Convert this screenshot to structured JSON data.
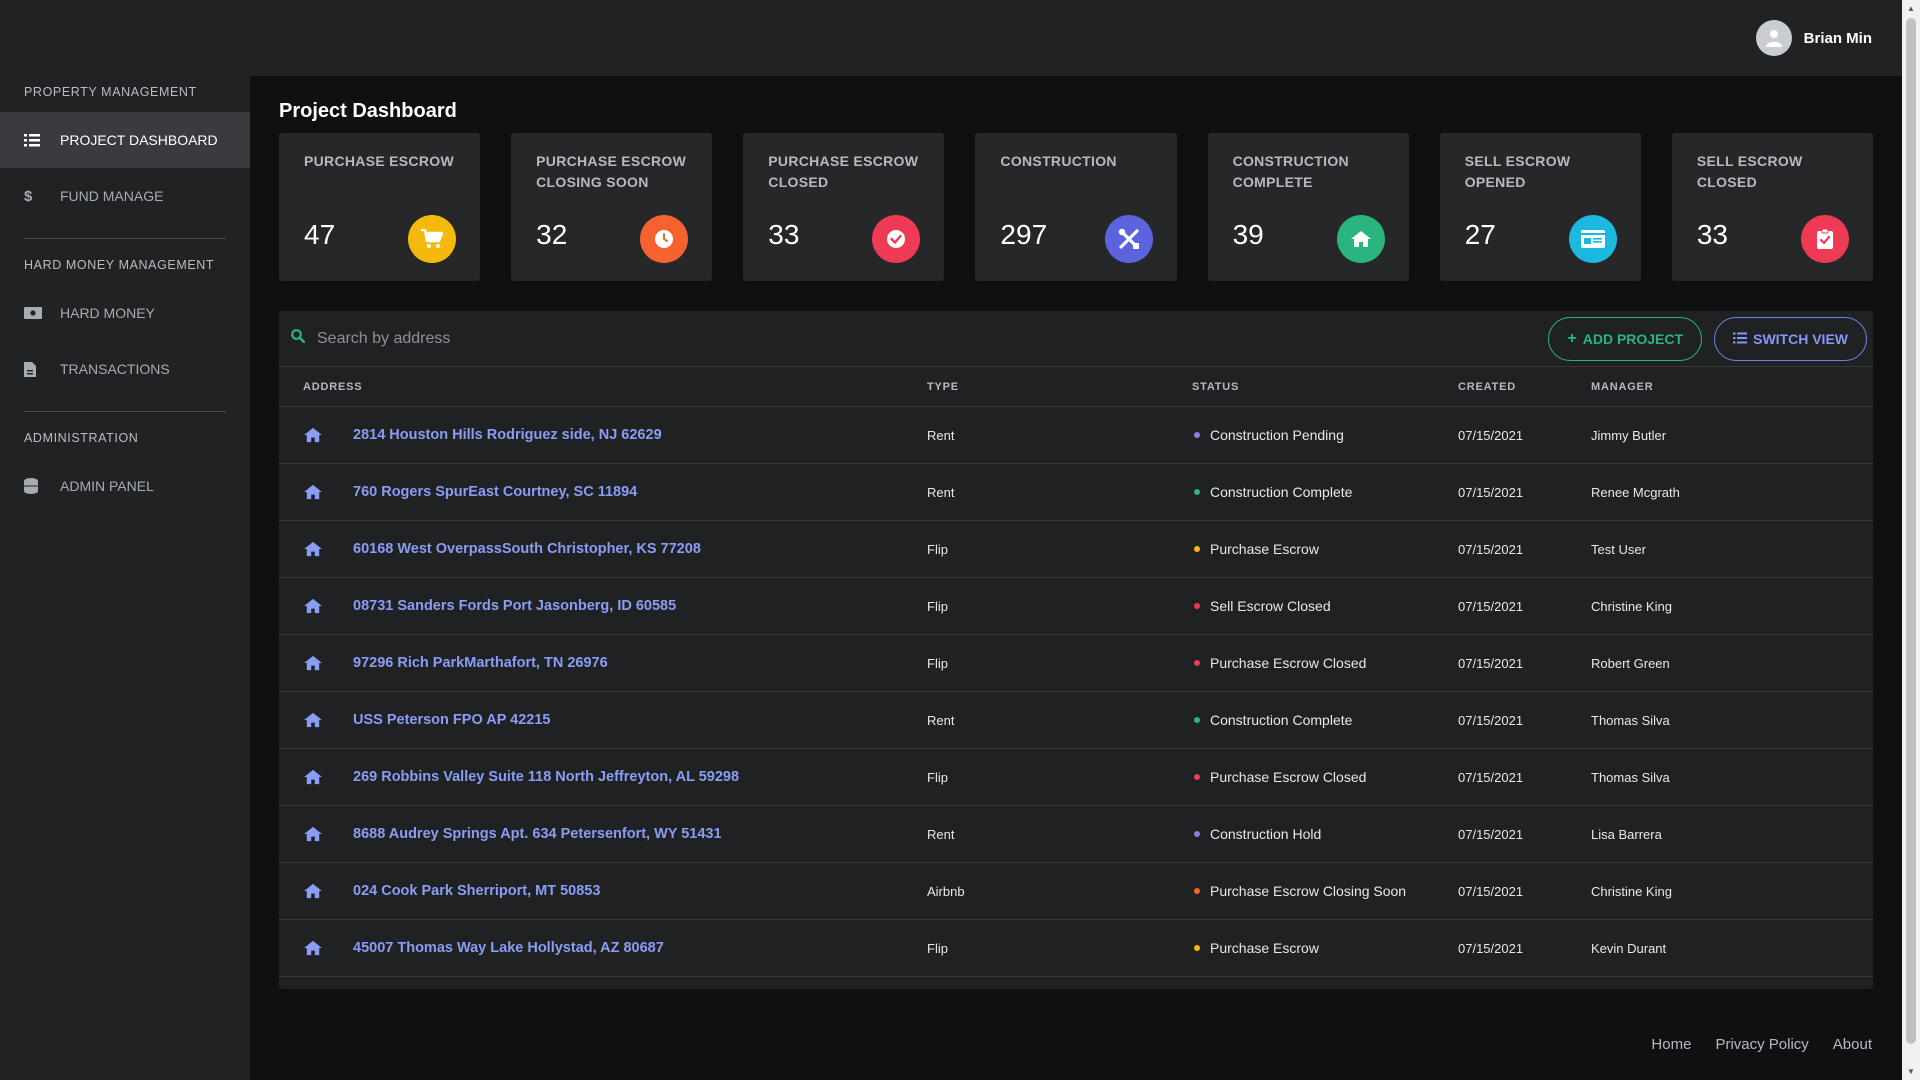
{
  "user": {
    "name": "Brian Min"
  },
  "sidebar": {
    "sections": [
      {
        "label": "PROPERTY MANAGEMENT",
        "items": [
          {
            "label": "PROJECT DASHBOARD",
            "icon": "list-icon",
            "active": true
          },
          {
            "label": "FUND MANAGE",
            "icon": "dollar-icon"
          }
        ]
      },
      {
        "label": "HARD MONEY MANAGEMENT",
        "items": [
          {
            "label": "HARD MONEY",
            "icon": "money-bill-icon"
          },
          {
            "label": "TRANSACTIONS",
            "icon": "file-invoice-icon"
          }
        ]
      },
      {
        "label": "ADMINISTRATION",
        "items": [
          {
            "label": "ADMIN PANEL",
            "icon": "database-icon"
          }
        ]
      }
    ]
  },
  "page": {
    "title": "Project Dashboard"
  },
  "cards": [
    {
      "title": "PURCHASE ESCROW",
      "value": "47",
      "color": "#f5b90d",
      "icon": "cart-icon"
    },
    {
      "title": "PURCHASE ESCROW CLOSING SOON",
      "value": "32",
      "color": "#f5622f",
      "icon": "clock-icon"
    },
    {
      "title": "PURCHASE ESCROW CLOSED",
      "value": "33",
      "color": "#ef3a55",
      "icon": "check-circle-icon"
    },
    {
      "title": "CONSTRUCTION",
      "value": "297",
      "color": "#5b64dc",
      "icon": "tools-icon"
    },
    {
      "title": "CONSTRUCTION COMPLETE",
      "value": "39",
      "color": "#2ab57d",
      "icon": "home-icon"
    },
    {
      "title": "SELL ESCROW OPENED",
      "value": "27",
      "color": "#1bb8e0",
      "icon": "id-card-icon"
    },
    {
      "title": "SELL ESCROW CLOSED",
      "value": "33",
      "color": "#ef3a55",
      "icon": "clipboard-check-icon"
    }
  ],
  "search": {
    "placeholder": "Search by address"
  },
  "buttons": {
    "add_project": "ADD PROJECT",
    "switch_view": "SWITCH VIEW"
  },
  "table": {
    "headers": {
      "address": "ADDRESS",
      "type": "TYPE",
      "status": "STATUS",
      "created": "CREATED",
      "manager": "MANAGER"
    },
    "rows": [
      {
        "address": "2814 Houston Hills Rodriguez side, NJ 62629",
        "type": "Rent",
        "status": "Construction Pending",
        "status_color": "#8a7cf0",
        "created": "07/15/2021",
        "manager": "Jimmy Butler"
      },
      {
        "address": "760 Rogers SpurEast Courtney, SC 11894",
        "type": "Rent",
        "status": "Construction Complete",
        "status_color": "#2ab57d",
        "created": "07/15/2021",
        "manager": "Renee Mcgrath"
      },
      {
        "address": "60168 West OverpassSouth Christopher, KS 77208",
        "type": "Flip",
        "status": "Purchase Escrow",
        "status_color": "#f5b90d",
        "created": "07/15/2021",
        "manager": "Test User"
      },
      {
        "address": "08731 Sanders Fords Port Jasonberg, ID 60585",
        "type": "Flip",
        "status": "Sell Escrow Closed",
        "status_color": "#ef3a55",
        "created": "07/15/2021",
        "manager": "Christine King"
      },
      {
        "address": "97296 Rich ParkMarthafort, TN 26976",
        "type": "Flip",
        "status": "Purchase Escrow Closed",
        "status_color": "#ef3a55",
        "created": "07/15/2021",
        "manager": "Robert Green"
      },
      {
        "address": "USS Peterson FPO AP 42215",
        "type": "Rent",
        "status": "Construction Complete",
        "status_color": "#2ab57d",
        "created": "07/15/2021",
        "manager": "Thomas Silva"
      },
      {
        "address": "269 Robbins Valley Suite 118 North Jeffreyton, AL 59298",
        "type": "Flip",
        "status": "Purchase Escrow Closed",
        "status_color": "#ef3a55",
        "created": "07/15/2021",
        "manager": "Thomas Silva"
      },
      {
        "address": "8688 Audrey Springs Apt. 634 Petersenfort, WY 51431",
        "type": "Rent",
        "status": "Construction Hold",
        "status_color": "#8a7cf0",
        "created": "07/15/2021",
        "manager": "Lisa Barrera"
      },
      {
        "address": "024 Cook Park Sherriport, MT 50853",
        "type": "Airbnb",
        "status": "Purchase Escrow Closing Soon",
        "status_color": "#f5622f",
        "created": "07/15/2021",
        "manager": "Christine King"
      },
      {
        "address": "45007 Thomas Way Lake Hollystad, AZ 80687",
        "type": "Flip",
        "status": "Purchase Escrow",
        "status_color": "#f5b90d",
        "created": "07/15/2021",
        "manager": "Kevin Durant"
      }
    ]
  },
  "footer": {
    "links": [
      "Home",
      "Privacy Policy",
      "About"
    ]
  }
}
